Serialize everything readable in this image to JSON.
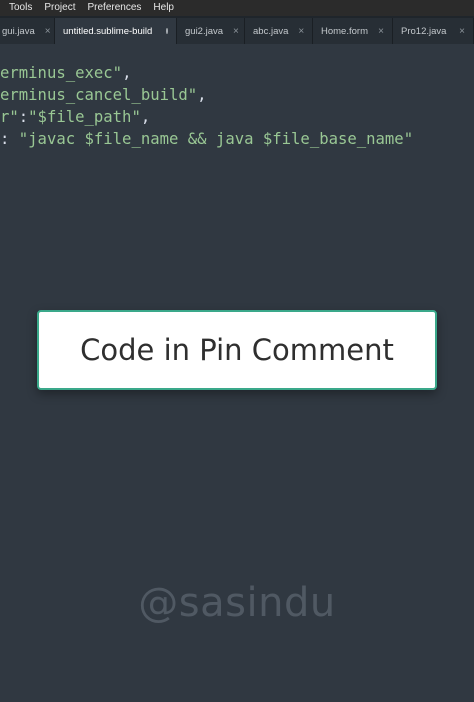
{
  "menubar": {
    "items": [
      "Tools",
      "Project",
      "Preferences",
      "Help"
    ]
  },
  "tabs": [
    {
      "label": "gui.java",
      "close": "×"
    },
    {
      "label": "untitled.sublime-build",
      "active": true
    },
    {
      "label": "gui2.java",
      "close": "×"
    },
    {
      "label": "abc.java",
      "close": "×"
    },
    {
      "label": "Home.form",
      "close": "×"
    },
    {
      "label": "Pro12.java",
      "close": "×"
    }
  ],
  "code": {
    "lines": [
      {
        "text": "erminus_exec\"",
        "tail": ","
      },
      {
        "text": "erminus_cancel_build\"",
        "tail": ","
      },
      {
        "lead": "r\"",
        "mid": ":",
        "text": "\"$file_path\"",
        "tail": ","
      },
      {
        "lead": ": ",
        "text": "\"javac $file_name && java $file_base_name\""
      }
    ]
  },
  "overlay": {
    "pin_text": "Code in Pin Comment"
  },
  "watermark": {
    "text": "@sasindu"
  }
}
